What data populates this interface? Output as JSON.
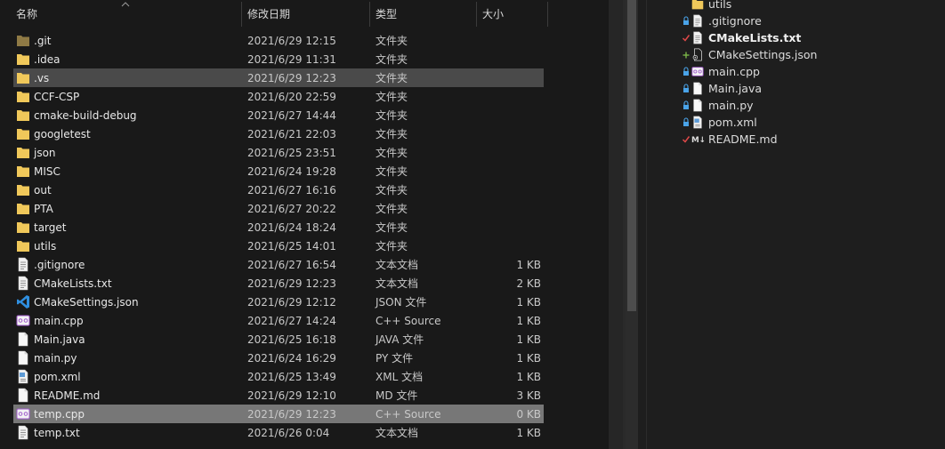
{
  "explorer": {
    "columns": {
      "name": "名称",
      "date": "修改日期",
      "type": "类型",
      "size": "大小"
    },
    "rows": [
      {
        "name": ".git",
        "date": "2021/6/29 12:15",
        "type": "文件夹",
        "size": "",
        "icon": "folder-dark-icon"
      },
      {
        "name": ".idea",
        "date": "2021/6/29 11:31",
        "type": "文件夹",
        "size": "",
        "icon": "folder-icon"
      },
      {
        "name": ".vs",
        "date": "2021/6/29 12:23",
        "type": "文件夹",
        "size": "",
        "icon": "folder-icon",
        "state": "selected"
      },
      {
        "name": "CCF-CSP",
        "date": "2021/6/20 22:59",
        "type": "文件夹",
        "size": "",
        "icon": "folder-icon"
      },
      {
        "name": "cmake-build-debug",
        "date": "2021/6/27 14:44",
        "type": "文件夹",
        "size": "",
        "icon": "folder-icon"
      },
      {
        "name": "googletest",
        "date": "2021/6/21 22:03",
        "type": "文件夹",
        "size": "",
        "icon": "folder-icon"
      },
      {
        "name": "json",
        "date": "2021/6/25 23:51",
        "type": "文件夹",
        "size": "",
        "icon": "folder-icon"
      },
      {
        "name": "MISC",
        "date": "2021/6/24 19:28",
        "type": "文件夹",
        "size": "",
        "icon": "folder-icon"
      },
      {
        "name": "out",
        "date": "2021/6/27 16:16",
        "type": "文件夹",
        "size": "",
        "icon": "folder-icon"
      },
      {
        "name": "PTA",
        "date": "2021/6/27 20:22",
        "type": "文件夹",
        "size": "",
        "icon": "folder-icon"
      },
      {
        "name": "target",
        "date": "2021/6/24 18:24",
        "type": "文件夹",
        "size": "",
        "icon": "folder-icon"
      },
      {
        "name": "utils",
        "date": "2021/6/25 14:01",
        "type": "文件夹",
        "size": "",
        "icon": "folder-icon"
      },
      {
        "name": ".gitignore",
        "date": "2021/6/27 16:54",
        "type": "文本文档",
        "size": "1 KB",
        "icon": "text-file-icon"
      },
      {
        "name": "CMakeLists.txt",
        "date": "2021/6/29 12:23",
        "type": "文本文档",
        "size": "2 KB",
        "icon": "text-file-icon"
      },
      {
        "name": "CMakeSettings.json",
        "date": "2021/6/29 12:12",
        "type": "JSON 文件",
        "size": "1 KB",
        "icon": "vscode-icon"
      },
      {
        "name": "main.cpp",
        "date": "2021/6/27 14:24",
        "type": "C++ Source",
        "size": "1 KB",
        "icon": "cpp-file-icon"
      },
      {
        "name": "Main.java",
        "date": "2021/6/25 16:18",
        "type": "JAVA 文件",
        "size": "1 KB",
        "icon": "blank-file-icon"
      },
      {
        "name": "main.py",
        "date": "2021/6/24 16:29",
        "type": "PY 文件",
        "size": "1 KB",
        "icon": "blank-file-icon"
      },
      {
        "name": "pom.xml",
        "date": "2021/6/25 13:49",
        "type": "XML 文档",
        "size": "1 KB",
        "icon": "xml-file-icon"
      },
      {
        "name": "README.md",
        "date": "2021/6/29 12:10",
        "type": "MD 文件",
        "size": "3 KB",
        "icon": "blank-file-icon"
      },
      {
        "name": "temp.cpp",
        "date": "2021/6/29 12:23",
        "type": "C++ Source",
        "size": "0 KB",
        "icon": "cpp-file-icon",
        "state": "hover"
      },
      {
        "name": "temp.txt",
        "date": "2021/6/26 0:04",
        "type": "文本文档",
        "size": "1 KB",
        "icon": "text-file-icon"
      }
    ]
  },
  "solution_tree": {
    "items": [
      {
        "name": "utils",
        "status": "",
        "icon": "folder-icon",
        "bold": false
      },
      {
        "name": ".gitignore",
        "status": "lock",
        "icon": "text-file-icon",
        "bold": false
      },
      {
        "name": "CMakeLists.txt",
        "status": "check",
        "icon": "text-file-icon",
        "bold": true
      },
      {
        "name": "CMakeSettings.json",
        "status": "plus",
        "icon": "settings-file-icon",
        "bold": false
      },
      {
        "name": "main.cpp",
        "status": "lock",
        "icon": "cpp-file-icon",
        "bold": false
      },
      {
        "name": "Main.java",
        "status": "lock",
        "icon": "blank-file-icon",
        "bold": false
      },
      {
        "name": "main.py",
        "status": "lock",
        "icon": "blank-file-icon",
        "bold": false
      },
      {
        "name": "pom.xml",
        "status": "lock",
        "icon": "xml-file-icon",
        "bold": false
      },
      {
        "name": "README.md",
        "status": "check",
        "icon": "markdown-icon",
        "bold": false
      }
    ]
  },
  "colors": {
    "folder": "#f0c85a",
    "folder_dark": "#8f7a45",
    "vscode_blue": "#2f8fe0",
    "cpp_purple": "#a15ccc",
    "status_lock": "#4aa3e8",
    "status_check": "#e04848",
    "status_plus": "#7ab648"
  }
}
